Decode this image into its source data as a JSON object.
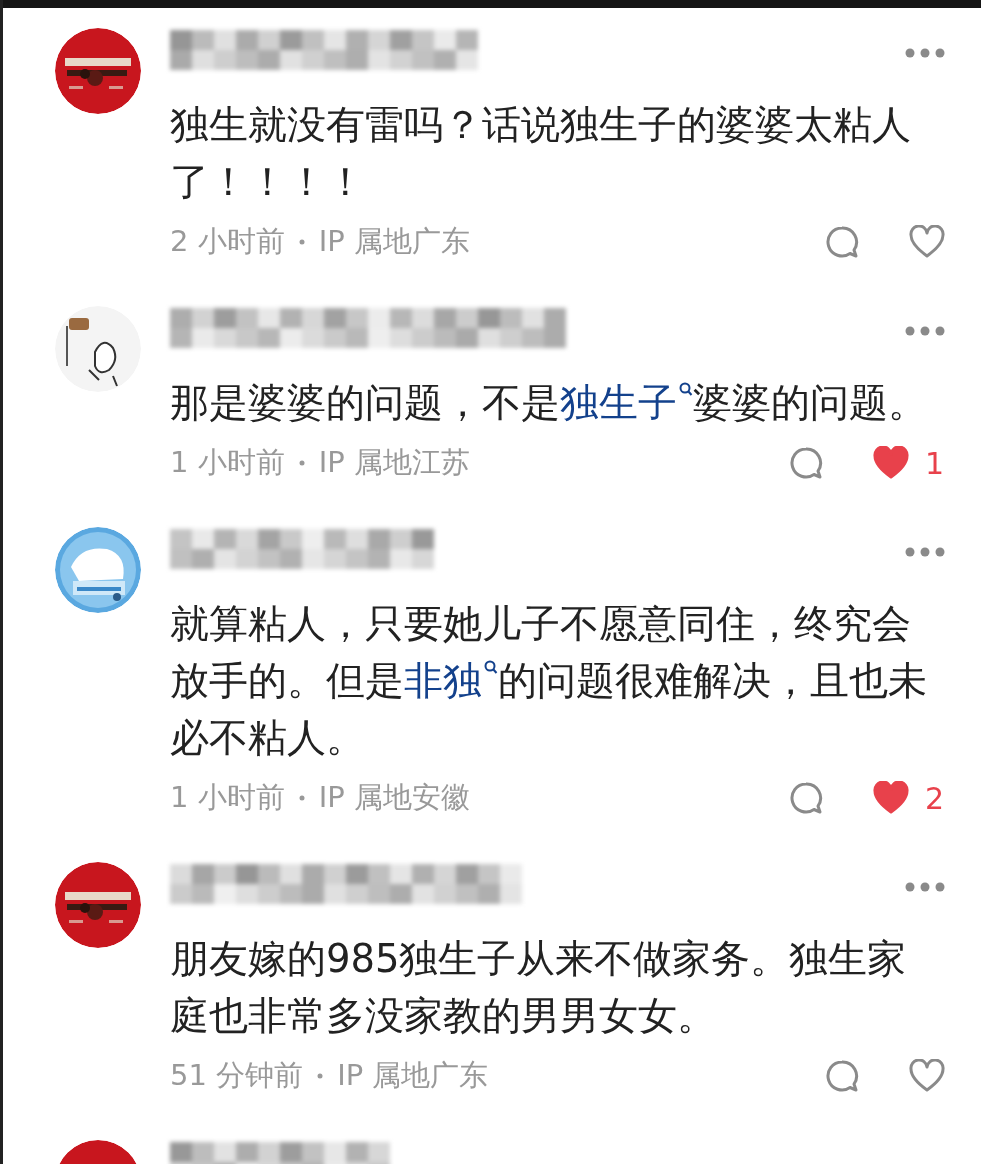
{
  "comments": [
    {
      "avatar": {
        "kind": "picture"
      },
      "text": [
        {
          "kind": "text",
          "text": "独生就没有雷吗？话说独生子的婆婆太粘人了！！！！"
        }
      ],
      "time": "2 小时前",
      "location": "IP 属地广东",
      "liked": false
    },
    {
      "avatar": {
        "kind": "picture"
      },
      "text": [
        {
          "kind": "text",
          "text": "那是婆婆的问题，不是"
        },
        {
          "kind": "link",
          "text": "独生子"
        },
        {
          "kind": "text",
          "text": "婆婆的问题。"
        }
      ],
      "time": "1 小时前",
      "location": "IP 属地江苏",
      "liked": true,
      "likes": "1"
    },
    {
      "avatar": {
        "kind": "picture"
      },
      "text": [
        {
          "kind": "text",
          "text": "就算粘人，只要她儿子不愿意同住，终究会放手的。但是"
        },
        {
          "kind": "link",
          "text": "非独"
        },
        {
          "kind": "text",
          "text": "的问题很难解决，且也未必不粘人。"
        }
      ],
      "time": "1 小时前",
      "location": "IP 属地安徽",
      "liked": true,
      "likes": "2"
    },
    {
      "avatar": {
        "kind": "picture"
      },
      "text": [
        {
          "kind": "text",
          "text": "朋友嫁的985独生子从来不做家务。独生家庭也非常多没家教的男男女女。"
        }
      ],
      "time": "51 分钟前",
      "location": "IP 属地广东",
      "liked": false
    },
    {
      "avatar": {
        "kind": "picture"
      }
    }
  ]
}
